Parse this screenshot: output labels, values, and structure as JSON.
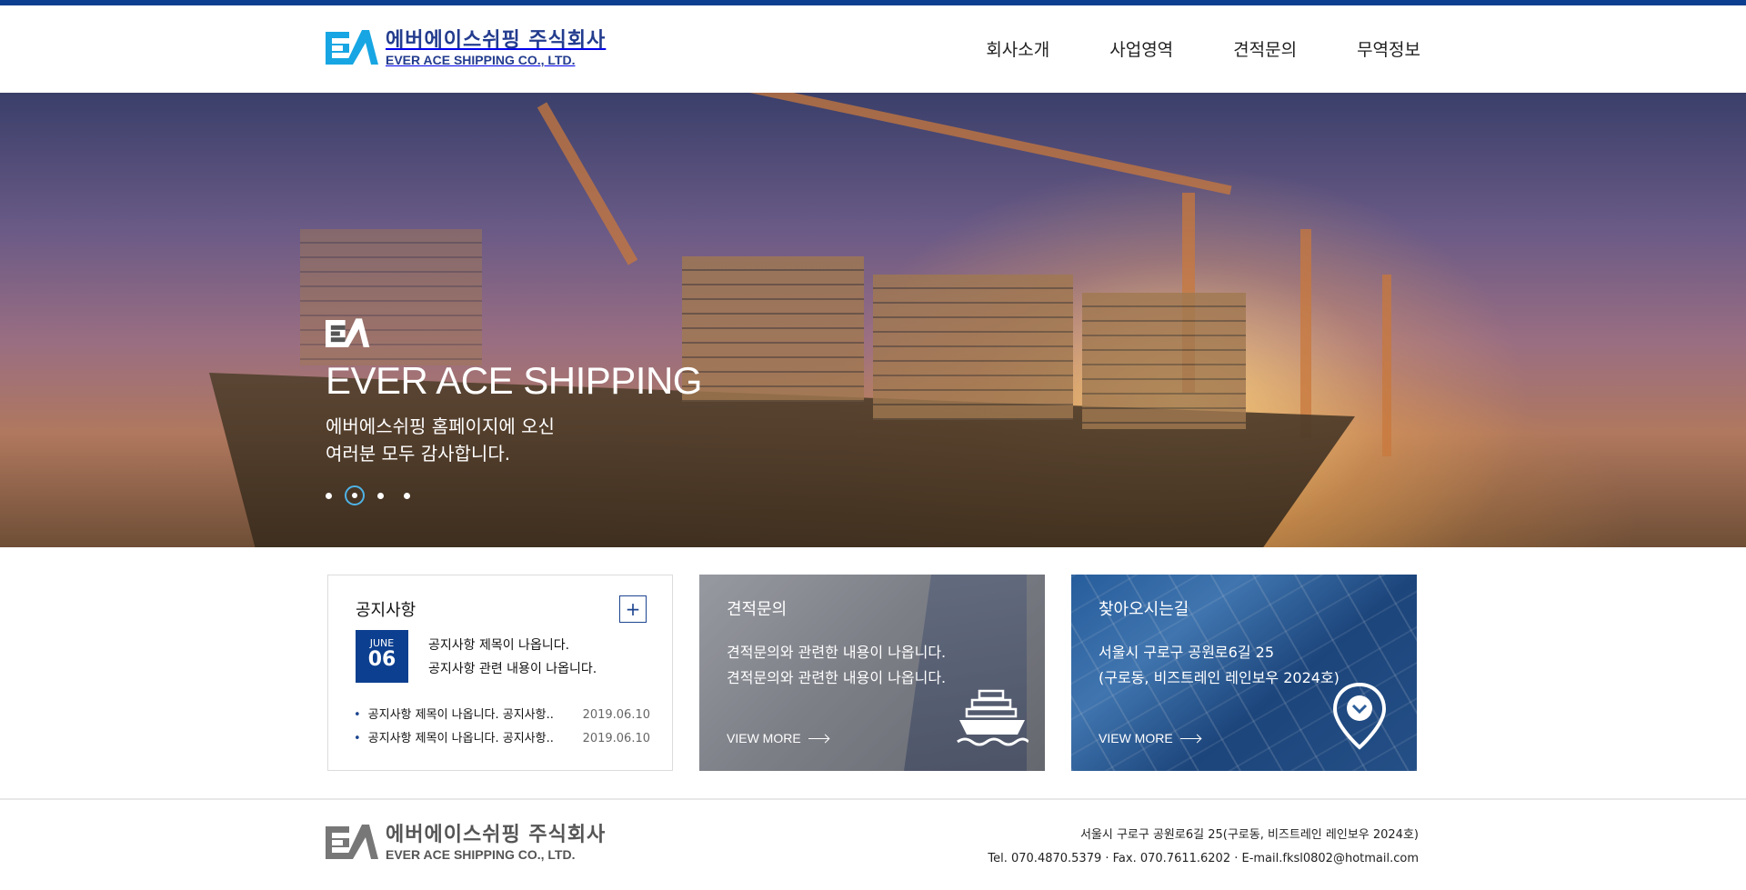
{
  "header": {
    "logo_ko": "에버에이스쉬핑 주식회사",
    "logo_en": "EVER ACE SHIPPING CO., LTD.",
    "nav": [
      "회사소개",
      "사업영역",
      "견적문의",
      "무역정보"
    ]
  },
  "hero": {
    "title": "EVER ACE SHIPPING",
    "subtitle_line1": "에버에스쉬핑 홈페이지에 오신",
    "subtitle_line2": "여러분 모두 감사합니다.",
    "slide_count": 4,
    "active_slide": 2
  },
  "notice": {
    "title": "공지사항",
    "plus": "+",
    "featured": {
      "month": "JUNE",
      "day": "06",
      "title": "공지사항 제목이 나옵니다.",
      "desc": "공지사항 관련 내용이 나옵니다."
    },
    "items": [
      {
        "title": "공지사항 제목이 나옵니다. 공지사항..",
        "date": "2019.06.10"
      },
      {
        "title": "공지사항 제목이 나옵니다. 공지사항..",
        "date": "2019.06.10"
      }
    ]
  },
  "quote_card": {
    "title": "견적문의",
    "line1": "견적문의와 관련한 내용이 나옵니다.",
    "line2": "견적문의와 관련한 내용이 나옵니다.",
    "more": "VIEW MORE"
  },
  "location_card": {
    "title": "찾아오시는길",
    "line1": "서울시 구로구 공원로6길 25",
    "line2": "(구로동, 비즈트레인 레인보우 2024호)",
    "more": "VIEW MORE"
  },
  "footer": {
    "logo_ko": "에버에이스쉬핑 주식회사",
    "logo_en": "EVER ACE SHIPPING CO., LTD.",
    "address": "서울시 구로구 공원로6길 25(구로동, 비즈트레인 레인보우 2024호)",
    "contact": "Tel. 070.4870.5379 · Fax. 070.7611.6202 · E-mail.fksl0802@hotmail.com"
  },
  "colors": {
    "brand_navy": "#0c3f8f",
    "brand_cyan": "#17a6e3",
    "logo_text": "#233c8e"
  }
}
